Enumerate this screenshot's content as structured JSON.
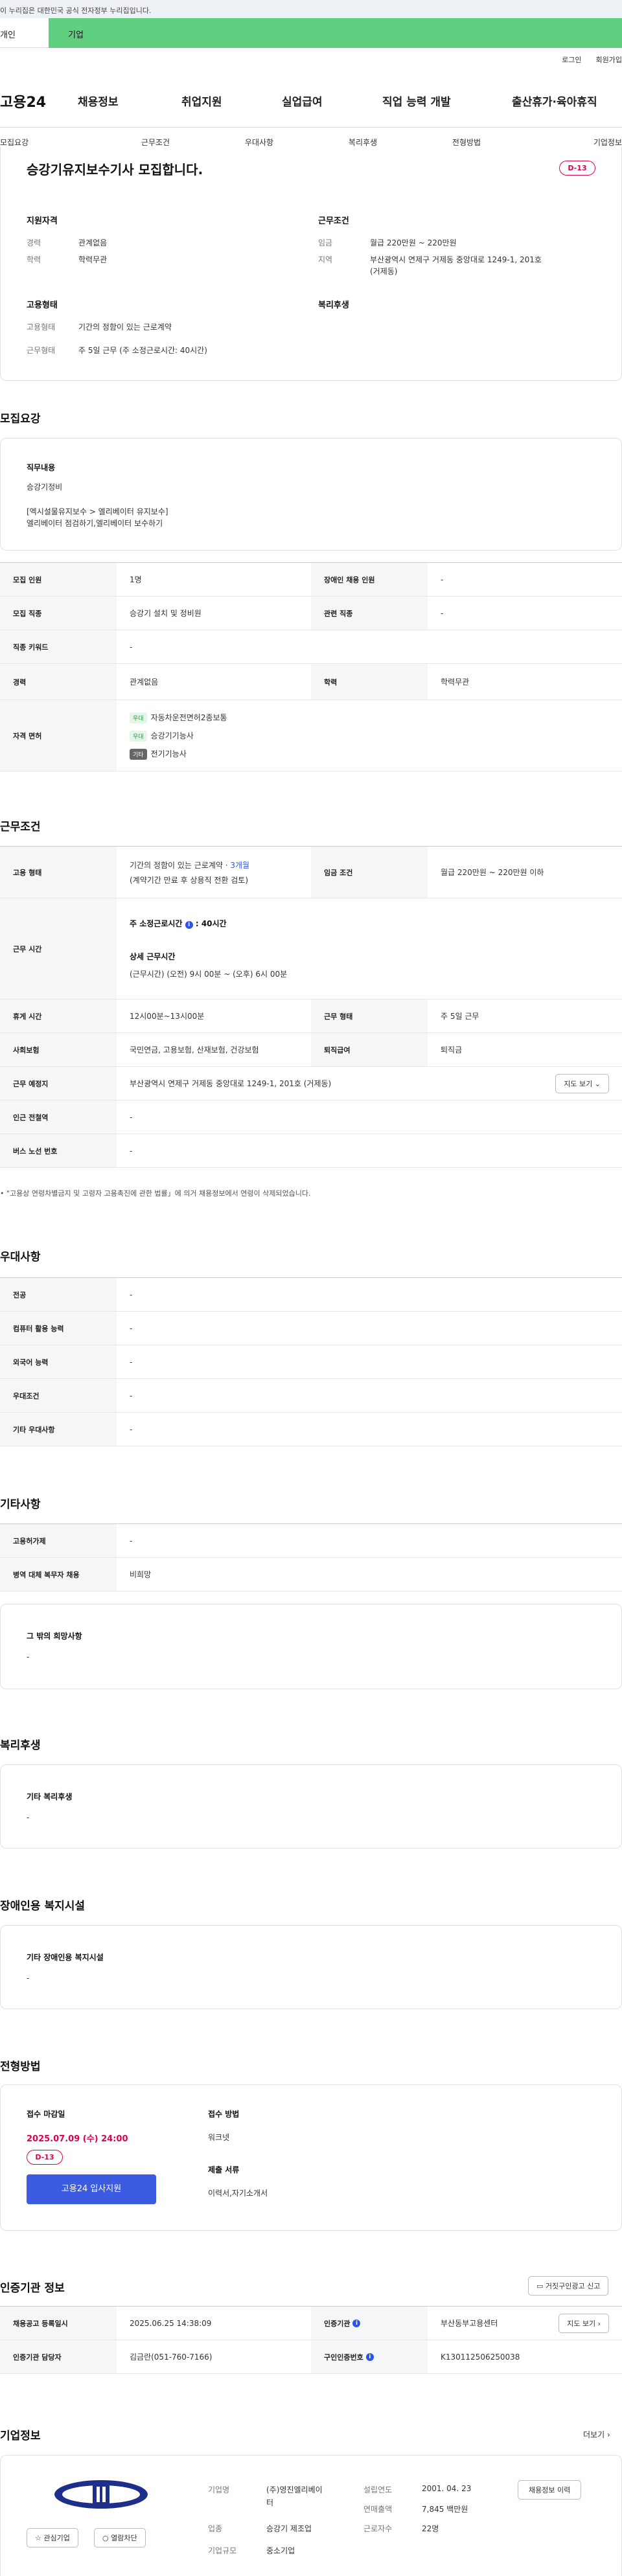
{
  "gov_banner": "이 누리집은 대한민국 공식 전자정부 누리집입니다.",
  "top_tabs": [
    "개인",
    "기업"
  ],
  "util_links": [
    "로그인",
    "회원가입"
  ],
  "logo": "고용24",
  "gnb": [
    "채용정보",
    "취업지원",
    "실업급여",
    "직업 능력 개발",
    "출산휴가·육아휴직"
  ],
  "lnb": [
    "모집요강",
    "근무조건",
    "우대사항",
    "복리후생",
    "전형방법",
    "기업정보"
  ],
  "summary": {
    "title": "승강기유지보수기사 모집합니다.",
    "dday": "D-13",
    "qual_title": "지원자격",
    "career_label": "경력",
    "career_value": "관계없음",
    "edu_label": "학력",
    "edu_value": "학력무관",
    "work_title": "근무조건",
    "wage_label": "임금",
    "wage_value": "월급 220만원 ~ 220만원",
    "area_label": "지역",
    "area_value1": "부산광역시 연제구 거제동 중앙대로 1249-1, 201호",
    "area_value2": "(거제동)",
    "emp_title": "고용형태",
    "emp_label": "고용형태",
    "emp_value": "기간의 정함이 있는 근로계약",
    "hours_label": "근무형태",
    "hours_value": "주 5일 근무 (주 소정근로시간: 40시간)",
    "welfare_title": "복리후생"
  },
  "recruit": {
    "title": "모집요강",
    "job_title": "직무내용",
    "job_line1": "승강기정비",
    "job_line2": "[엑시설물유지보수 > 엘리베이터 유지보수]",
    "job_line3": "엘리베이터 점검하기,엘리베이터 보수하기",
    "rows": {
      "count_h": "모집 인원",
      "count_v": "1명",
      "disabled_h": "장애인 채용 인원",
      "disabled_v": "-",
      "job_h": "모집 직종",
      "job_v": "승강기 설치 및 정비원",
      "rel_h": "관련 직종",
      "rel_v": "-",
      "kw_h": "직종 키워드",
      "kw_v": "-",
      "career_h": "경력",
      "career_v": "관계없음",
      "edu_h": "학력",
      "edu_v": "학력무관",
      "lic_h": "자격 면허",
      "lic": [
        {
          "tag": "우대",
          "name": "자동차운전면허2종보통"
        },
        {
          "tag": "우대",
          "name": "승강기기능사"
        },
        {
          "tag": "기타",
          "name": "전기기능사"
        }
      ]
    }
  },
  "work": {
    "title": "근무조건",
    "type_h": "고용 형태",
    "type_v1": "기간의 정함이 있는 근로계약 · ",
    "type_v1b": "3개월",
    "type_v2": "(계약기간 만료 후 상용직 전환 검토)",
    "wage_h": "임금 조건",
    "wage_v": "월급 220만원 ~ 220만원 이하",
    "time_h": "근무 시간",
    "time_l1": "주 소정근로시간",
    "time_l1b": ": 40시간",
    "time_l2": "상세 근무시간",
    "time_l3": "(근무시간) (오전) 9시 00분 ~ (오후) 6시 00분",
    "rest_h": "휴게 시간",
    "rest_v": "12시00분~13시00분",
    "form_h": "근무 형태",
    "form_v": "주 5일 근무",
    "ins_h": "사회보험",
    "ins_v": "국민연금, 고용보험, 산재보험, 건강보험",
    "ret_h": "퇴직급여",
    "ret_v": "퇴직금",
    "place_h": "근무 예정지",
    "place_v": "부산광역시 연제구 거제동 중앙대로 1249-1, 201호 (거제동)",
    "map_btn": "지도 보기",
    "sub_h": "인근 전철역",
    "sub_v": "-",
    "bus_h": "버스 노선 번호",
    "bus_v": "-",
    "note": "\"고용상 연령차별금지 및 고령자 고용촉진에 관한 법률」에 의거 채용정보에서 연령이 삭제되었습니다."
  },
  "pref": {
    "title": "우대사항",
    "rows": [
      {
        "h": "전공",
        "v": "-"
      },
      {
        "h": "컴퓨터 활용 능력",
        "v": "-"
      },
      {
        "h": "외국어 능력",
        "v": "-"
      },
      {
        "h": "우대조건",
        "v": "-"
      },
      {
        "h": "기타 우대사항",
        "v": "-"
      }
    ]
  },
  "etc": {
    "title": "기타사항",
    "rows": [
      {
        "h": "고용허가제",
        "v": "-"
      },
      {
        "h": "병역 대체 복무자 채용",
        "v": "비희망"
      }
    ],
    "box_title": "그 밖의 희망사항",
    "box_value": "-"
  },
  "welfare": {
    "title": "복리후생",
    "box_title": "기타 복리후생",
    "box_value": "-"
  },
  "disabled": {
    "title": "장애인용 복지시설",
    "box_title": "기타 장애인용 복지시설",
    "box_value": "-"
  },
  "process": {
    "title": "전형방법",
    "deadline_label": "접수 마감일",
    "deadline_value": "2025.07.09 (수) 24:00",
    "dday": "D-13",
    "apply_btn": "고용24 입사지원",
    "method_label": "접수 방법",
    "method_value": "워크넷",
    "docs_label": "제출 서류",
    "docs_value": "이력서,자기소개서"
  },
  "agency": {
    "title": "인증기관 정보",
    "report_btn": "거짓구인광고 신고",
    "reg_h": "채용공고 등록일시",
    "reg_v": "2025.06.25 14:38:09",
    "org_h": "인증기관",
    "org_v": "부산동부고용센터",
    "map_btn": "지도 보기",
    "mgr_h": "인증기관 담당자",
    "mgr_v": "김금란(051-760-7166)",
    "id_h": "구인인증번호",
    "id_v": "K130112506250038"
  },
  "company": {
    "title": "기업정보",
    "more": "더보기",
    "fav_btn": "관심기업",
    "block_btn": "열람차단",
    "name_label": "기업명",
    "name_value1": "(주)영진엘리베이",
    "name_value2": "터",
    "ind_label": "업종",
    "ind_value": "승강기 제조업",
    "size_label": "기업규모",
    "size_value": "중소기업",
    "year_label": "설립연도",
    "year_value": "2001. 04. 23",
    "sales_label": "연매출액",
    "sales_value": "7,845 백만원",
    "emp_label": "근로자수",
    "emp_value": "22명",
    "history_btn": "채용정보 이력"
  }
}
